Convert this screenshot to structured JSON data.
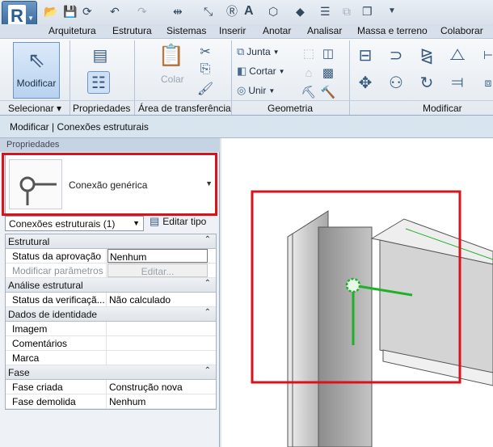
{
  "app": {
    "logo_letter": "R"
  },
  "tabs": [
    "Arquitetura",
    "Estrutura",
    "Sistemas",
    "Inserir",
    "Anotar",
    "Analisar",
    "Massa e terreno",
    "Colaborar"
  ],
  "ribbon": {
    "modify_label": "Modificar",
    "paste_label": "Colar",
    "join_label": "Junta",
    "cut_label": "Cortar",
    "unite_label": "Unir",
    "panels": {
      "select": "Selecionar ▾",
      "properties": "Propriedades",
      "clipboard": "Área de transferência",
      "geometry": "Geometria",
      "modify": "Modificar"
    }
  },
  "context_bar": "Modificar | Conexões estruturais",
  "properties": {
    "header": "Propriedades",
    "type_name": "Conexão genérica",
    "filter": "Conexões estruturais (1)",
    "edit_type": "Editar tipo",
    "groups": [
      {
        "name": "Estrutural",
        "rows": [
          {
            "key": "Status da aprovação",
            "value": "Nenhum",
            "style": "box"
          },
          {
            "key": "Modificar parâmetros",
            "value": "Editar...",
            "style": "btn",
            "disabled": true
          }
        ]
      },
      {
        "name": "Análise estrutural",
        "rows": [
          {
            "key": "Status da verificaçã...",
            "value": "Não calculado"
          }
        ]
      },
      {
        "name": "Dados de identidade",
        "rows": [
          {
            "key": "Imagem",
            "value": ""
          },
          {
            "key": "Comentários",
            "value": ""
          },
          {
            "key": "Marca",
            "value": ""
          }
        ]
      },
      {
        "name": "Fase",
        "rows": [
          {
            "key": "Fase criada",
            "value": "Construção nova"
          },
          {
            "key": "Fase demolida",
            "value": "Nenhum"
          }
        ]
      }
    ]
  },
  "colors": {
    "highlight_red": "#d9131b",
    "connection_green": "#1fb02a",
    "ribbon_blue": "#dceafa"
  }
}
